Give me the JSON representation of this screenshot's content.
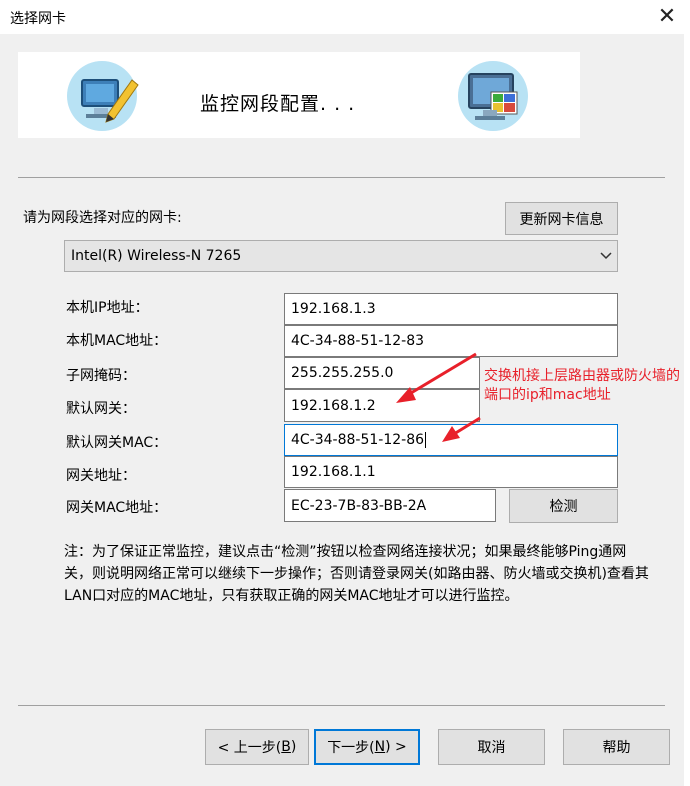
{
  "window": {
    "title": "选择网卡",
    "close_glyph": "✕"
  },
  "banner": {
    "title": "监控网段配置. . ."
  },
  "adapter": {
    "prompt": "请为网段选择对应的网卡:",
    "refresh_button": "更新网卡信息",
    "selected": "Intel(R) Wireless-N 7265"
  },
  "fields": [
    {
      "label": "本机IP地址：",
      "value": "192.168.1.3"
    },
    {
      "label": "本机MAC地址：",
      "value": "4C-34-88-51-12-83"
    },
    {
      "label": "子网掩码：",
      "value": "255.255.255.0"
    },
    {
      "label": "默认网关：",
      "value": "192.168.1.2"
    },
    {
      "label": "默认网关MAC：",
      "value": "4C-34-88-51-12-86"
    },
    {
      "label": "网关地址：",
      "value": "192.168.1.1"
    },
    {
      "label": "网关MAC地址：",
      "value": "EC-23-7B-83-BB-2A"
    }
  ],
  "detect_button": "检测",
  "note": "注：为了保证正常监控，建议点击“检测”按钮以检查网络连接状况；如果最终能够Ping通网关，则说明网络正常可以继续下一步操作；否则请登录网关(如路由器、防火墙或交换机)查看其LAN口对应的MAC地址，只有获取正确的网关MAC地址才可以进行监控。",
  "annotation": "交换机接上层路由器或防火墙的端口的ip和mac地址",
  "buttons": {
    "back": {
      "prefix": "< 上一步(",
      "key": "B",
      "suffix": ")"
    },
    "next": {
      "prefix": "下一步(",
      "key": "N",
      "suffix": ") >"
    },
    "cancel": "取消",
    "help": "帮助"
  },
  "colors": {
    "annotation": "#e8202a",
    "focus": "#0078d7",
    "icon_circle": "#b8e2f4"
  }
}
